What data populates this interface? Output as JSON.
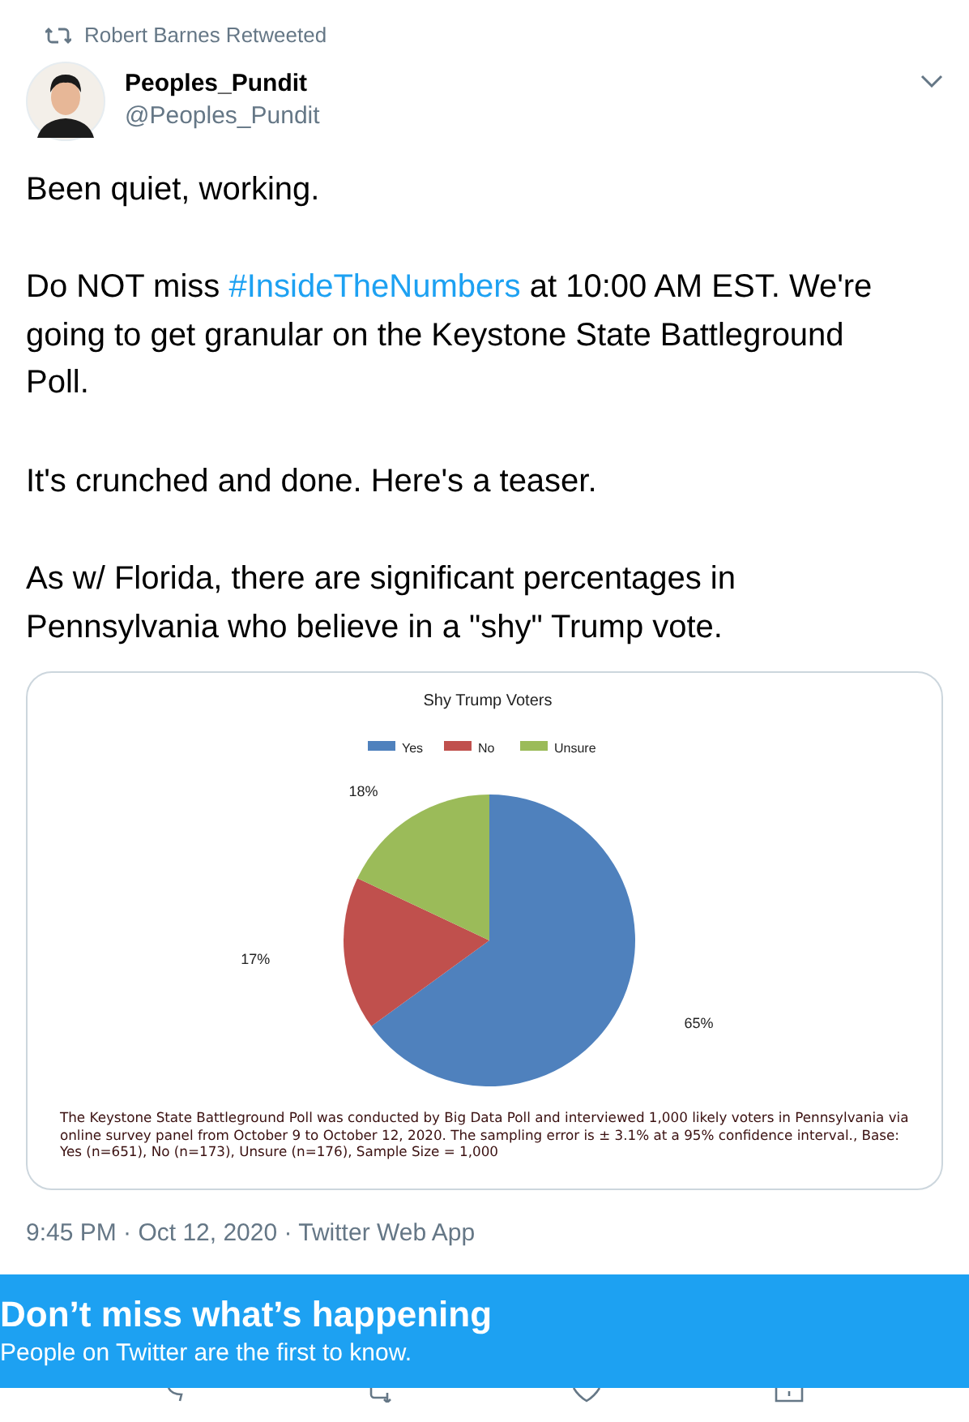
{
  "retweet_note": "Robert Barnes Retweeted",
  "author": {
    "name": "Peoples_Pundit",
    "handle": "@Peoples_Pundit"
  },
  "paragraphs": [
    {
      "text": "Been quiet, working."
    },
    {
      "before": "Do NOT miss ",
      "hashtag": "#InsideTheNumbers",
      "after": " at 10:00 AM EST. We're going to get granular on the Keystone State Battleground Poll."
    },
    {
      "text": "It's crunched and done. Here's a teaser."
    },
    {
      "text": "As w/ Florida, there are significant percentages in Pennsylvania who believe in a \"shy\" Trump vote."
    }
  ],
  "chart": {
    "chart_data": {
      "type": "pie",
      "title": "Shy Trump Voters",
      "categories": [
        "Yes",
        "No",
        "Unsure"
      ],
      "series": [
        {
          "values": [
            65,
            17,
            18
          ]
        }
      ],
      "legend": true,
      "colors": [
        "#4f81bd",
        "#c0504d",
        "#9bbb59"
      ],
      "value_labels": [
        "65%",
        "17%",
        "18%"
      ]
    },
    "caption": "The Keystone State Battleground Poll was conducted by Big Data Poll and interviewed 1,000 likely voters in Pennsylvania via online survey panel from October 9 to October 12, 2020. The sampling error is ± 3.1% at a 95% confidence interval., Base: Yes (n=651), No (n=173), Unsure (n=176), Sample Size = 1,000"
  },
  "timestamp": "9:45 PM · Oct 12, 2020 · Twitter Web App",
  "banner": {
    "title": "Don’t miss what’s happening",
    "subtitle": "People on Twitter are the first to know."
  }
}
